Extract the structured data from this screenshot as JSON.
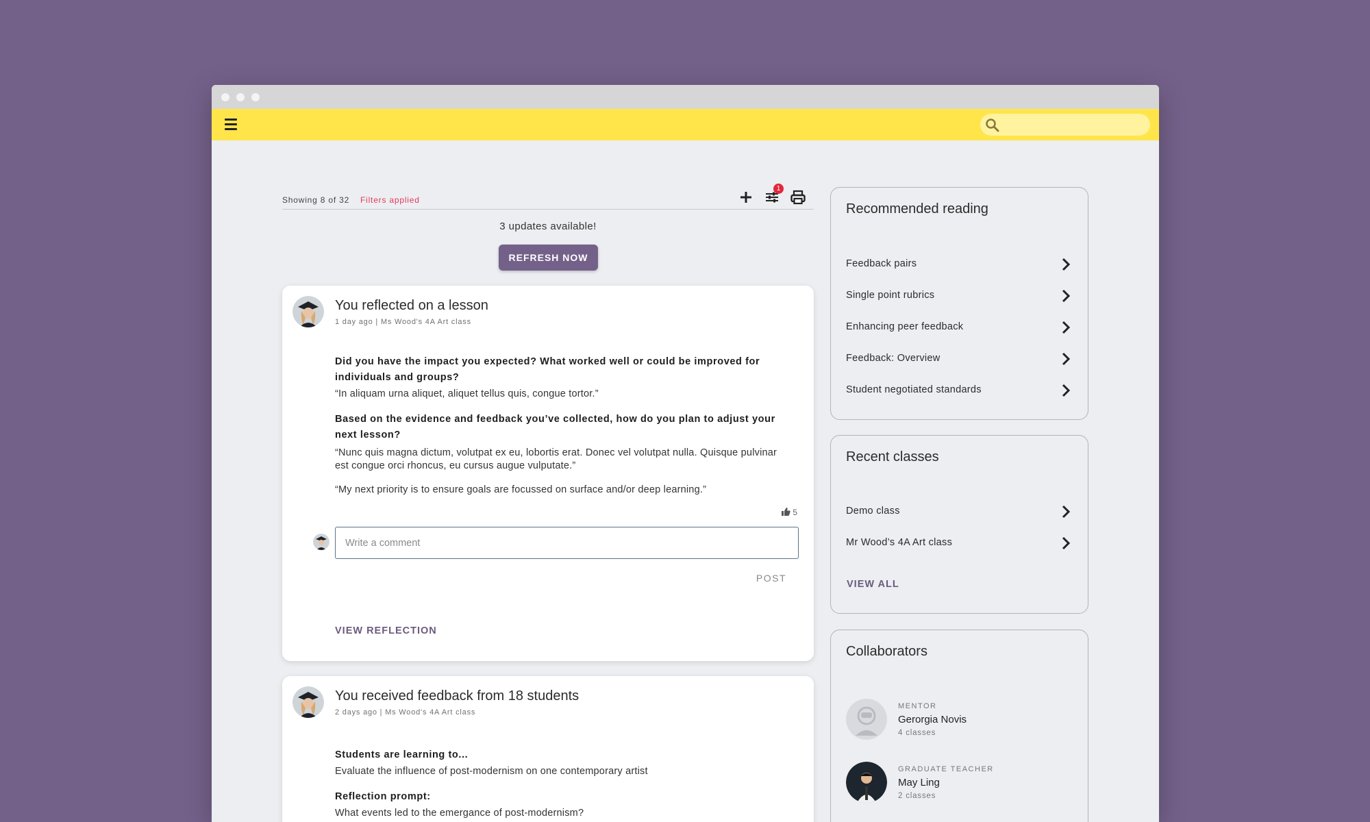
{
  "feed": {
    "showing": "Showing 8 of 32",
    "filters": "Filters applied",
    "filter_badge": "1",
    "updates": "3 updates available!",
    "refresh_label": "REFRESH NOW"
  },
  "posts": [
    {
      "title": "You reflected on a lesson",
      "meta": "1 day ago | Ms Wood's 4A Art class",
      "q1": "Did you have the impact you expected? What worked well or could be improved for individuals and groups?",
      "a1": "“In aliquam urna aliquet, aliquet tellus quis, congue tortor.”",
      "q2": "Based on the evidence and feedback you’ve collected, how do you plan to adjust your next lesson?",
      "a2": "“Nunc quis magna dictum, volutpat ex eu, lobortis erat. Donec vel volutpat nulla. Quisque pulvinar est congue orci rhoncus, eu cursus augue vulputate.”",
      "a3": "“My next priority is to ensure goals are focussed on surface and/or deep learning.”",
      "likes": "5",
      "comment_placeholder": "Write a comment",
      "post_label": "POST",
      "view_label": "VIEW REFLECTION"
    },
    {
      "title": "You received feedback from 18 students",
      "meta": "2 days ago | Ms Wood's 4A Art class",
      "q1": "Students are learning to...",
      "a1": "Evaluate the influence of post-modernism on one contemporary artist",
      "q2": "Reflection prompt:",
      "a2": "What events led to the emergance of post-modernism?"
    }
  ],
  "reading": {
    "title": "Recommended reading",
    "items": [
      "Feedback pairs",
      "Single point rubrics",
      "Enhancing peer feedback",
      "Feedback: Overview",
      "Student negotiated standards"
    ]
  },
  "classes": {
    "title": "Recent classes",
    "items": [
      "Demo class",
      "Mr Wood’s 4A Art class"
    ],
    "view_all": "VIEW ALL"
  },
  "collaborators": {
    "title": "Collaborators",
    "people": [
      {
        "role": "MENTOR",
        "name": "Gerorgia Novis",
        "count": "4 classes"
      },
      {
        "role": "GRADUATE TEACHER",
        "name": "May Ling",
        "count": "2 classes"
      }
    ]
  },
  "colors": {
    "background": "#74618a",
    "topbar": "#ffe54a",
    "accent": "#74618a",
    "filter_red": "#e2395a"
  }
}
